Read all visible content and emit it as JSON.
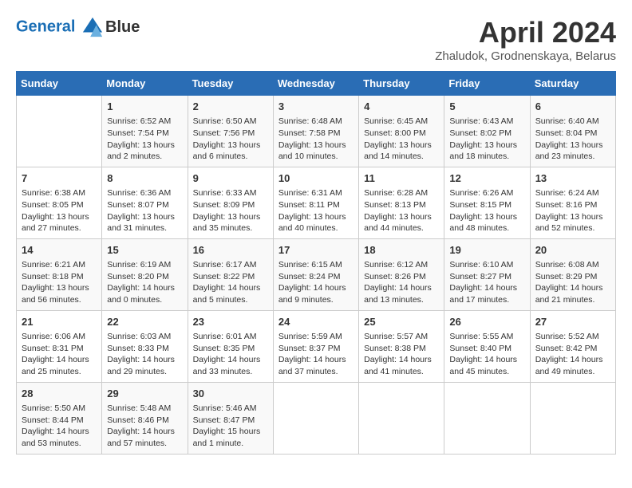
{
  "header": {
    "logo_line1": "General",
    "logo_line2": "Blue",
    "month": "April 2024",
    "location": "Zhaludok, Grodnenskaya, Belarus"
  },
  "days_of_week": [
    "Sunday",
    "Monday",
    "Tuesday",
    "Wednesday",
    "Thursday",
    "Friday",
    "Saturday"
  ],
  "weeks": [
    [
      {
        "day": "",
        "sunrise": "",
        "sunset": "",
        "daylight": ""
      },
      {
        "day": "1",
        "sunrise": "Sunrise: 6:52 AM",
        "sunset": "Sunset: 7:54 PM",
        "daylight": "Daylight: 13 hours and 2 minutes."
      },
      {
        "day": "2",
        "sunrise": "Sunrise: 6:50 AM",
        "sunset": "Sunset: 7:56 PM",
        "daylight": "Daylight: 13 hours and 6 minutes."
      },
      {
        "day": "3",
        "sunrise": "Sunrise: 6:48 AM",
        "sunset": "Sunset: 7:58 PM",
        "daylight": "Daylight: 13 hours and 10 minutes."
      },
      {
        "day": "4",
        "sunrise": "Sunrise: 6:45 AM",
        "sunset": "Sunset: 8:00 PM",
        "daylight": "Daylight: 13 hours and 14 minutes."
      },
      {
        "day": "5",
        "sunrise": "Sunrise: 6:43 AM",
        "sunset": "Sunset: 8:02 PM",
        "daylight": "Daylight: 13 hours and 18 minutes."
      },
      {
        "day": "6",
        "sunrise": "Sunrise: 6:40 AM",
        "sunset": "Sunset: 8:04 PM",
        "daylight": "Daylight: 13 hours and 23 minutes."
      }
    ],
    [
      {
        "day": "7",
        "sunrise": "Sunrise: 6:38 AM",
        "sunset": "Sunset: 8:05 PM",
        "daylight": "Daylight: 13 hours and 27 minutes."
      },
      {
        "day": "8",
        "sunrise": "Sunrise: 6:36 AM",
        "sunset": "Sunset: 8:07 PM",
        "daylight": "Daylight: 13 hours and 31 minutes."
      },
      {
        "day": "9",
        "sunrise": "Sunrise: 6:33 AM",
        "sunset": "Sunset: 8:09 PM",
        "daylight": "Daylight: 13 hours and 35 minutes."
      },
      {
        "day": "10",
        "sunrise": "Sunrise: 6:31 AM",
        "sunset": "Sunset: 8:11 PM",
        "daylight": "Daylight: 13 hours and 40 minutes."
      },
      {
        "day": "11",
        "sunrise": "Sunrise: 6:28 AM",
        "sunset": "Sunset: 8:13 PM",
        "daylight": "Daylight: 13 hours and 44 minutes."
      },
      {
        "day": "12",
        "sunrise": "Sunrise: 6:26 AM",
        "sunset": "Sunset: 8:15 PM",
        "daylight": "Daylight: 13 hours and 48 minutes."
      },
      {
        "day": "13",
        "sunrise": "Sunrise: 6:24 AM",
        "sunset": "Sunset: 8:16 PM",
        "daylight": "Daylight: 13 hours and 52 minutes."
      }
    ],
    [
      {
        "day": "14",
        "sunrise": "Sunrise: 6:21 AM",
        "sunset": "Sunset: 8:18 PM",
        "daylight": "Daylight: 13 hours and 56 minutes."
      },
      {
        "day": "15",
        "sunrise": "Sunrise: 6:19 AM",
        "sunset": "Sunset: 8:20 PM",
        "daylight": "Daylight: 14 hours and 0 minutes."
      },
      {
        "day": "16",
        "sunrise": "Sunrise: 6:17 AM",
        "sunset": "Sunset: 8:22 PM",
        "daylight": "Daylight: 14 hours and 5 minutes."
      },
      {
        "day": "17",
        "sunrise": "Sunrise: 6:15 AM",
        "sunset": "Sunset: 8:24 PM",
        "daylight": "Daylight: 14 hours and 9 minutes."
      },
      {
        "day": "18",
        "sunrise": "Sunrise: 6:12 AM",
        "sunset": "Sunset: 8:26 PM",
        "daylight": "Daylight: 14 hours and 13 minutes."
      },
      {
        "day": "19",
        "sunrise": "Sunrise: 6:10 AM",
        "sunset": "Sunset: 8:27 PM",
        "daylight": "Daylight: 14 hours and 17 minutes."
      },
      {
        "day": "20",
        "sunrise": "Sunrise: 6:08 AM",
        "sunset": "Sunset: 8:29 PM",
        "daylight": "Daylight: 14 hours and 21 minutes."
      }
    ],
    [
      {
        "day": "21",
        "sunrise": "Sunrise: 6:06 AM",
        "sunset": "Sunset: 8:31 PM",
        "daylight": "Daylight: 14 hours and 25 minutes."
      },
      {
        "day": "22",
        "sunrise": "Sunrise: 6:03 AM",
        "sunset": "Sunset: 8:33 PM",
        "daylight": "Daylight: 14 hours and 29 minutes."
      },
      {
        "day": "23",
        "sunrise": "Sunrise: 6:01 AM",
        "sunset": "Sunset: 8:35 PM",
        "daylight": "Daylight: 14 hours and 33 minutes."
      },
      {
        "day": "24",
        "sunrise": "Sunrise: 5:59 AM",
        "sunset": "Sunset: 8:37 PM",
        "daylight": "Daylight: 14 hours and 37 minutes."
      },
      {
        "day": "25",
        "sunrise": "Sunrise: 5:57 AM",
        "sunset": "Sunset: 8:38 PM",
        "daylight": "Daylight: 14 hours and 41 minutes."
      },
      {
        "day": "26",
        "sunrise": "Sunrise: 5:55 AM",
        "sunset": "Sunset: 8:40 PM",
        "daylight": "Daylight: 14 hours and 45 minutes."
      },
      {
        "day": "27",
        "sunrise": "Sunrise: 5:52 AM",
        "sunset": "Sunset: 8:42 PM",
        "daylight": "Daylight: 14 hours and 49 minutes."
      }
    ],
    [
      {
        "day": "28",
        "sunrise": "Sunrise: 5:50 AM",
        "sunset": "Sunset: 8:44 PM",
        "daylight": "Daylight: 14 hours and 53 minutes."
      },
      {
        "day": "29",
        "sunrise": "Sunrise: 5:48 AM",
        "sunset": "Sunset: 8:46 PM",
        "daylight": "Daylight: 14 hours and 57 minutes."
      },
      {
        "day": "30",
        "sunrise": "Sunrise: 5:46 AM",
        "sunset": "Sunset: 8:47 PM",
        "daylight": "Daylight: 15 hours and 1 minute."
      },
      {
        "day": "",
        "sunrise": "",
        "sunset": "",
        "daylight": ""
      },
      {
        "day": "",
        "sunrise": "",
        "sunset": "",
        "daylight": ""
      },
      {
        "day": "",
        "sunrise": "",
        "sunset": "",
        "daylight": ""
      },
      {
        "day": "",
        "sunrise": "",
        "sunset": "",
        "daylight": ""
      }
    ]
  ]
}
